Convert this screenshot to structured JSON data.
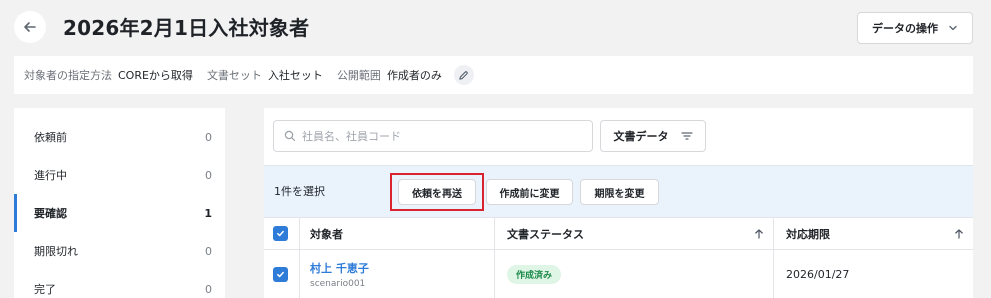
{
  "header": {
    "title": "2026年2月1日入社対象者",
    "data_ops_label": "データの操作"
  },
  "info": {
    "target_method_label": "対象者の指定方法",
    "target_method_value": "COREから取得",
    "doc_set_label": "文書セット",
    "doc_set_value": "入社セット",
    "visibility_label": "公開範囲",
    "visibility_value": "作成者のみ"
  },
  "sidebar": {
    "items": [
      {
        "label": "依頼前",
        "count": "0"
      },
      {
        "label": "進行中",
        "count": "0"
      },
      {
        "label": "要確認",
        "count": "1"
      },
      {
        "label": "期限切れ",
        "count": "0"
      },
      {
        "label": "完了",
        "count": "0"
      }
    ],
    "active_index": 2
  },
  "search": {
    "placeholder": "社員名、社員コード",
    "value": ""
  },
  "filter": {
    "doc_data_label": "文書データ"
  },
  "selection": {
    "count_text": "1件を選択",
    "resend_label": "依頼を再送",
    "to_pre_request_label": "作成前に変更",
    "change_deadline_label": "期限を変更"
  },
  "table": {
    "columns": [
      "対象者",
      "文書ステータス",
      "対応期限"
    ],
    "rows": [
      {
        "name": "村上 千恵子",
        "code": "scenario001",
        "status": "作成済み",
        "deadline": "2026/01/27",
        "checked": true
      }
    ]
  },
  "colors": {
    "accent": "#2f7bd8",
    "highlight": "#d9232e",
    "status_bg": "#dff5e6",
    "status_text": "#1e8a4a"
  }
}
